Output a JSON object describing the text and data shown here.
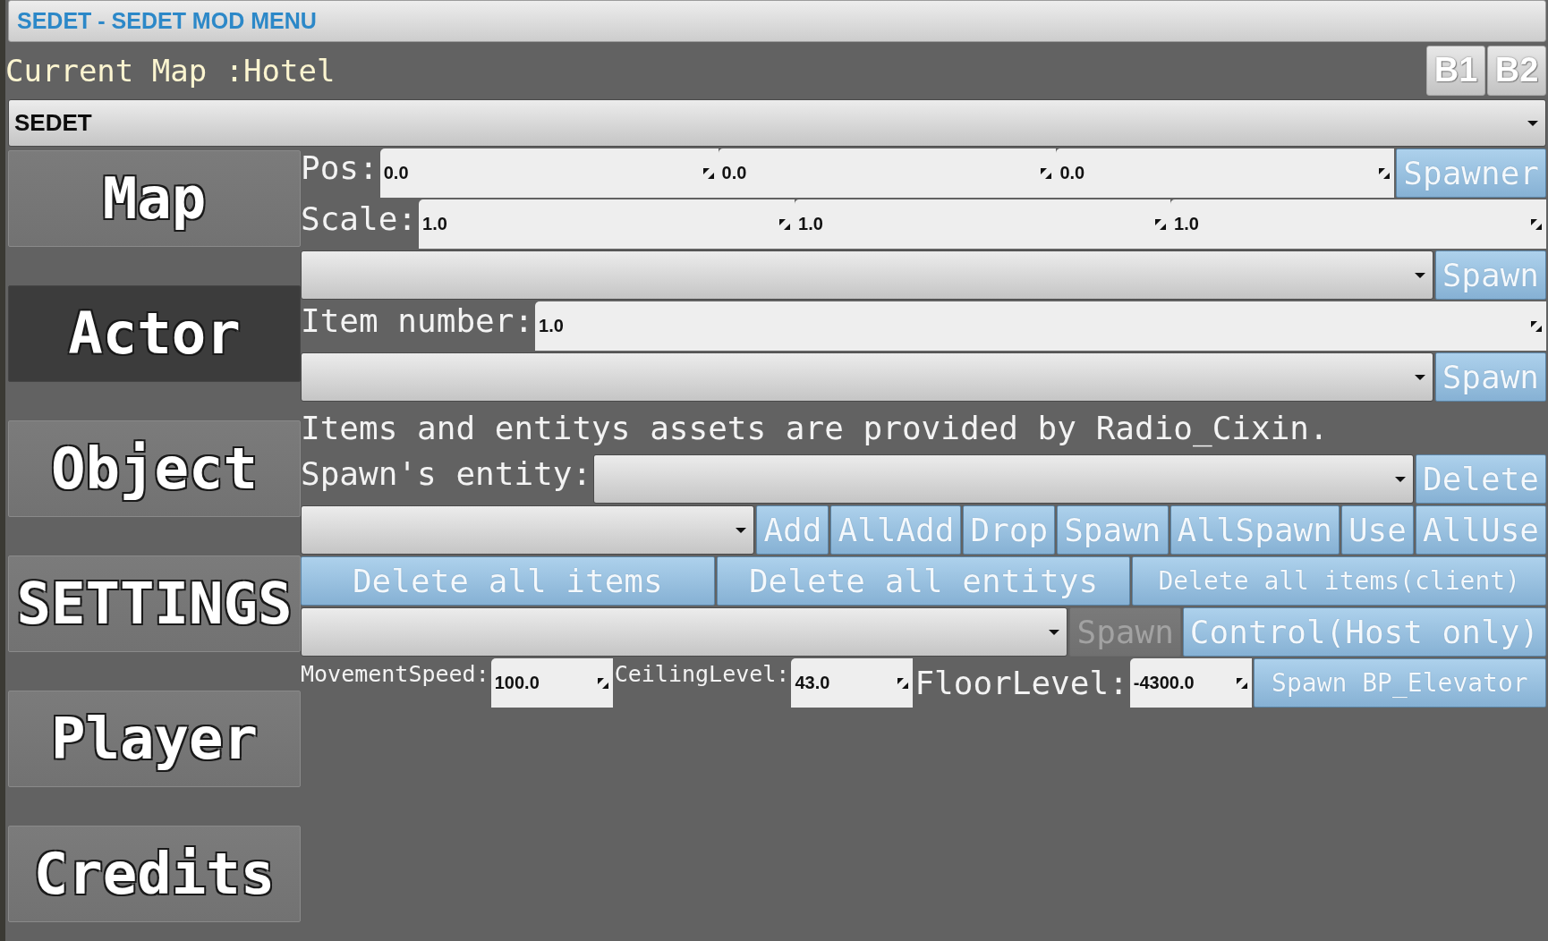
{
  "window": {
    "title": "SEDET - SEDET MOD MENU"
  },
  "header": {
    "current_map": "Current Map :Hotel",
    "buttons": [
      {
        "label": "B1"
      },
      {
        "label": "B2"
      }
    ]
  },
  "menu_select": {
    "value": "SEDET"
  },
  "sidebar": {
    "items": [
      {
        "label": "Map",
        "selected": false
      },
      {
        "label": "Actor",
        "selected": true
      },
      {
        "label": "Object",
        "selected": false
      },
      {
        "label": "SETTINGS",
        "selected": false
      },
      {
        "label": "Player",
        "selected": false
      },
      {
        "label": "Credits",
        "selected": false
      }
    ]
  },
  "panel": {
    "rows": [
      {
        "kind": "form",
        "items": [
          {
            "kind": "label",
            "text": "Pos:"
          },
          {
            "kind": "spinbox",
            "value": "0.0"
          },
          {
            "kind": "spinbox",
            "value": "0.0"
          },
          {
            "kind": "spinbox",
            "value": "0.0"
          },
          {
            "kind": "button",
            "label": "Spawner"
          }
        ]
      },
      {
        "kind": "form",
        "items": [
          {
            "kind": "label",
            "text": "Scale:"
          },
          {
            "kind": "spinbox",
            "value": "1.0"
          },
          {
            "kind": "spinbox",
            "value": "1.0"
          },
          {
            "kind": "spinbox",
            "value": "1.0"
          }
        ]
      },
      {
        "kind": "form",
        "items": [
          {
            "kind": "dropdown"
          },
          {
            "kind": "button",
            "label": "Spawn"
          }
        ]
      },
      {
        "kind": "form",
        "items": [
          {
            "kind": "label",
            "text": "Item number:"
          },
          {
            "kind": "spinbox",
            "value": "1.0"
          }
        ]
      },
      {
        "kind": "form",
        "items": [
          {
            "kind": "dropdown"
          },
          {
            "kind": "button",
            "label": "Spawn"
          }
        ]
      },
      {
        "kind": "note",
        "text": "Items and entitys assets are provided by Radio_Cixin."
      },
      {
        "kind": "form",
        "items": [
          {
            "kind": "label",
            "text": "Spawn's entity:"
          },
          {
            "kind": "dropdown"
          },
          {
            "kind": "button",
            "label": "Delete"
          }
        ]
      },
      {
        "kind": "form",
        "items": [
          {
            "kind": "dropdown"
          },
          {
            "kind": "button",
            "label": "Add"
          },
          {
            "kind": "button",
            "label": "AllAdd"
          },
          {
            "kind": "button",
            "label": "Drop"
          },
          {
            "kind": "button",
            "label": "Spawn"
          },
          {
            "kind": "button",
            "label": "AllSpawn"
          },
          {
            "kind": "button",
            "label": "Use"
          },
          {
            "kind": "button",
            "label": "AllUse"
          }
        ]
      },
      {
        "kind": "button-bar",
        "items": [
          {
            "kind": "button",
            "label": "Delete all items"
          },
          {
            "kind": "button",
            "label": "Delete all entitys"
          },
          {
            "kind": "small-button",
            "label": "Delete all items(client)"
          }
        ]
      },
      {
        "kind": "form",
        "items": [
          {
            "kind": "dropdown",
            "disabled": false
          },
          {
            "kind": "button",
            "label": "Spawn",
            "disabled": true
          },
          {
            "kind": "button",
            "label": "Control(Host only)",
            "disabled": false
          }
        ]
      },
      {
        "kind": "inline",
        "items": [
          {
            "kind": "caption",
            "text": "MovementSpeed:"
          },
          {
            "kind": "spinbox",
            "value": "100.0"
          },
          {
            "kind": "caption",
            "text": "CeilingLevel:"
          },
          {
            "kind": "spinbox",
            "value": "43.0"
          },
          {
            "kind": "label",
            "text": "FloorLevel:"
          },
          {
            "kind": "spinbox",
            "value": "-4300.0"
          },
          {
            "kind": "small-button",
            "label": "Spawn BP_Elevator"
          }
        ]
      }
    ]
  }
}
